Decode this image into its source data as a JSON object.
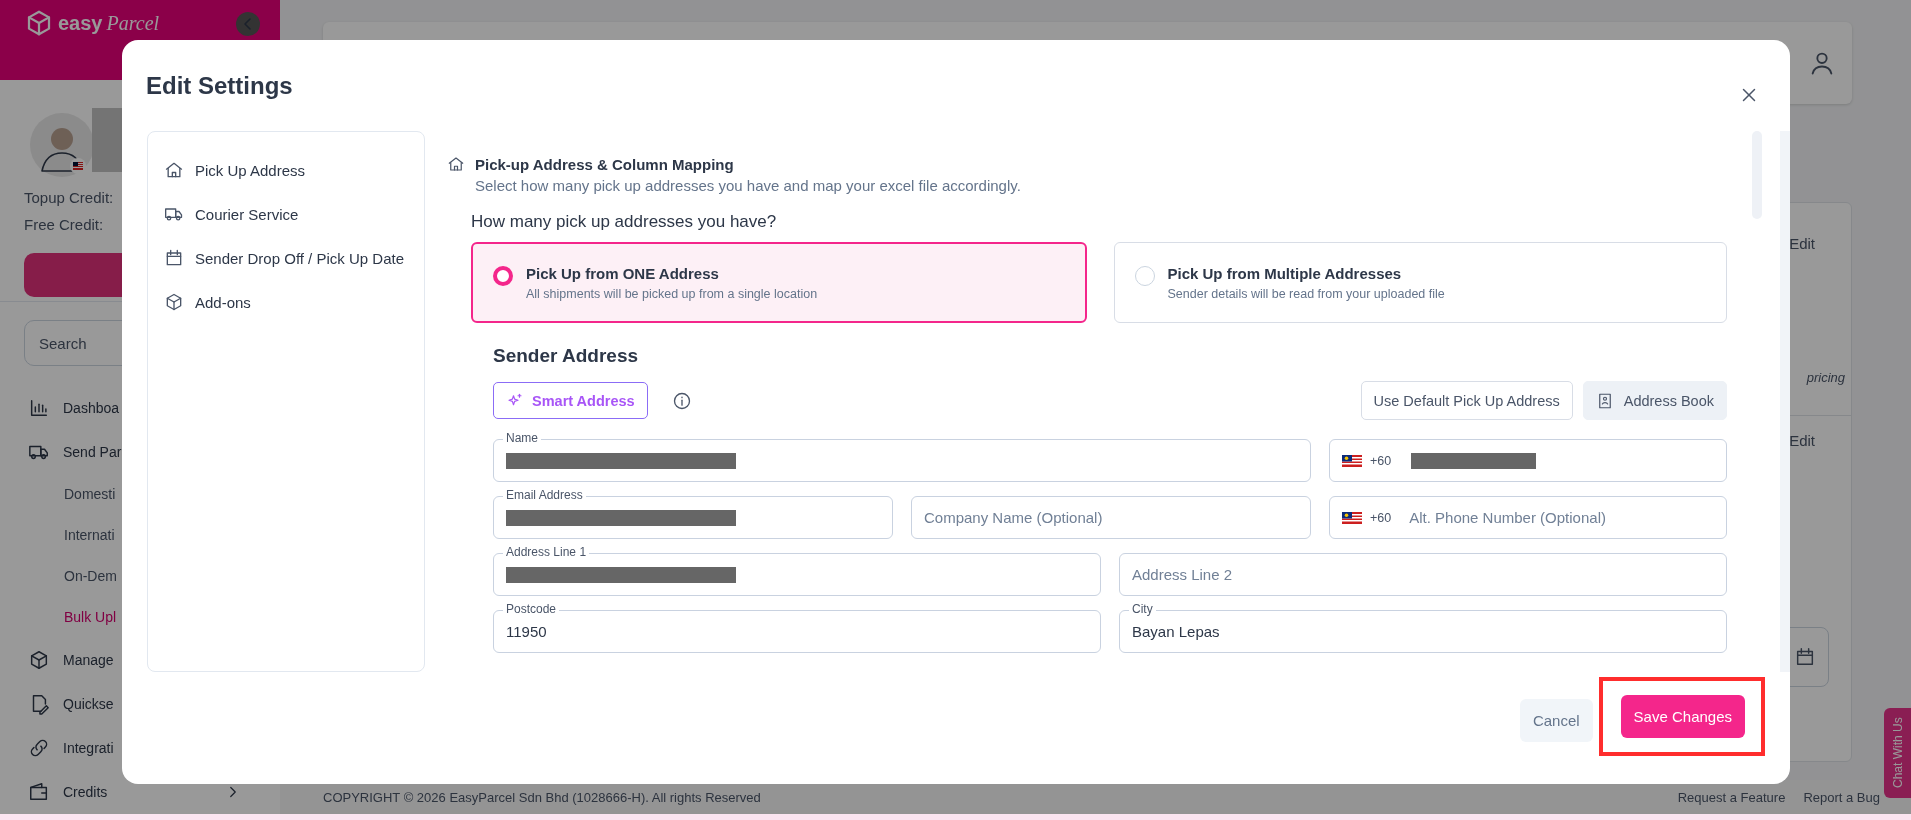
{
  "sidebar": {
    "logo": {
      "word_1": "easy",
      "word_2": "Parcel"
    },
    "credits": [
      {
        "label": "Topup Credit:"
      },
      {
        "label": "Free Credit:"
      }
    ],
    "search": {
      "placeholder": "Search"
    },
    "menu": [
      {
        "label": "Dashboa"
      },
      {
        "label": "Send Par",
        "children": [
          {
            "label": "Domesti",
            "selected": false
          },
          {
            "label": "Internati",
            "selected": false
          },
          {
            "label": "On-Dem",
            "selected": false
          },
          {
            "label": "Bulk Upl",
            "selected": true
          }
        ]
      },
      {
        "label": "Manage"
      },
      {
        "label": "Quickse"
      },
      {
        "label": "Integrati"
      },
      {
        "label": "Credits",
        "expanded": false
      }
    ]
  },
  "background_card": {
    "texts": [
      "Edit",
      "pricing",
      "Edit"
    ]
  },
  "footer": {
    "copyright": "COPYRIGHT © 2026 EasyParcel Sdn Bhd (1028666-H). All rights Reserved",
    "links": [
      "Request a Feature",
      "Report a Bug"
    ]
  },
  "chat_tab": {
    "label": "Chat With Us"
  },
  "modal": {
    "title": "Edit Settings",
    "nav": [
      {
        "label": "Pick Up Address"
      },
      {
        "label": "Courier Service"
      },
      {
        "label": "Sender Drop Off / Pick Up Date"
      },
      {
        "label": "Add-ons"
      }
    ],
    "section": {
      "title": "Pick-up Address & Column Mapping",
      "subtitle": "Select how many pick up addresses you have and map your excel file accordingly."
    },
    "question": "How many pick up addresses you have?",
    "options": [
      {
        "title": "Pick Up from ONE Address",
        "description": "All shipments will be picked up from a single location",
        "selected": true
      },
      {
        "title": "Pick Up from Multiple Addresses",
        "description": "Sender details will be read from your uploaded file",
        "selected": false
      }
    ],
    "sender": {
      "heading": "Sender Address",
      "smart_button": "Smart Address",
      "buttons": [
        {
          "label": "Use Default Pick Up Address",
          "kind": "outline"
        },
        {
          "label": "Address Book",
          "kind": "soft"
        }
      ],
      "rows": [
        {
          "fields": [
            {
              "kind": "text",
              "label": "Name",
              "redacted": true
            },
            {
              "kind": "phone",
              "code": "+60",
              "redacted": true
            }
          ]
        },
        {
          "fields": [
            {
              "kind": "text",
              "label": "Email Address",
              "redacted": true
            },
            {
              "kind": "text",
              "placeholder": "Company Name (Optional)"
            },
            {
              "kind": "phone",
              "code": "+60",
              "placeholder": "Alt. Phone Number (Optional)"
            }
          ]
        },
        {
          "fields": [
            {
              "kind": "text",
              "label": "Address Line 1",
              "redacted": true
            },
            {
              "kind": "text",
              "placeholder": "Address Line 2"
            }
          ]
        },
        {
          "fields": [
            {
              "kind": "text",
              "label": "Postcode",
              "value": "11950"
            },
            {
              "kind": "text",
              "label": "City",
              "value": "Bayan Lepas"
            }
          ]
        }
      ]
    },
    "actions": [
      {
        "label": "Cancel",
        "kind": "secondary",
        "highlighted": false
      },
      {
        "label": "Save Changes",
        "kind": "primary",
        "highlighted": true
      }
    ]
  }
}
